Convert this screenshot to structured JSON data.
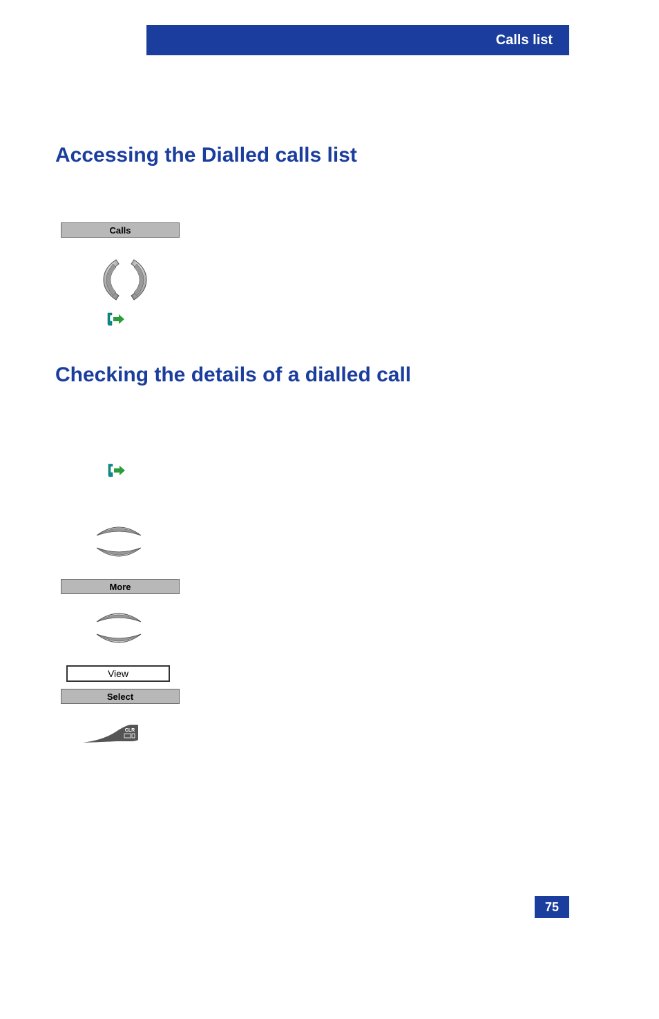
{
  "header": {
    "title": "Calls list"
  },
  "sections": {
    "heading1": "Accessing the Dialled calls list",
    "heading2": "Checking the details of a dialled call"
  },
  "buttons": {
    "calls": "Calls",
    "more": "More",
    "select": "Select",
    "view": "View"
  },
  "clr": {
    "label": "CLR"
  },
  "page": {
    "number": "75"
  }
}
